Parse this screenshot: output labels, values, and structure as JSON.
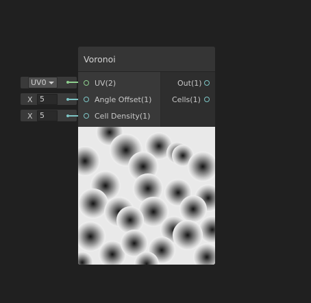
{
  "node": {
    "title": "Voronoi",
    "inputs": [
      "UV(2)",
      "Angle Offset(1)",
      "Cell Density(1)"
    ],
    "outputs": [
      "Out(1)",
      "Cells(1)"
    ]
  },
  "inline": {
    "uv_value": "UV0",
    "angle_axis": "X",
    "angle_value": "5",
    "density_axis": "X",
    "density_value": "5"
  },
  "colors": {
    "uv_port": "#8fd18f",
    "float_port": "#7ec7c7",
    "background": "#202020"
  },
  "icons": {
    "dropdown": "chevron-down-icon"
  }
}
